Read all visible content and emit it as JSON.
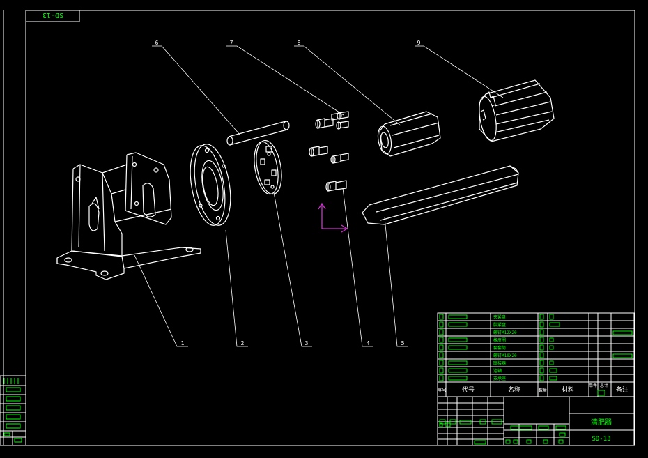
{
  "drawing": {
    "code_rotated": "SD-13",
    "title": "清肥器",
    "code": "SD-13"
  },
  "leaders": [
    "1",
    "2",
    "3",
    "4",
    "5",
    "6",
    "7",
    "8",
    "9"
  ],
  "bom": {
    "rows": [
      {
        "name": "夹紧盘"
      },
      {
        "name": "胶紧盘"
      },
      {
        "name": "螺钉M12X20"
      },
      {
        "name": "橡皮圈"
      },
      {
        "name": "套套筒"
      },
      {
        "name": "螺钉M10X20"
      },
      {
        "name": "联接器"
      },
      {
        "name": "连轴"
      },
      {
        "name": "支承座"
      }
    ],
    "header": {
      "seq": "序号",
      "code": "代号",
      "name": "名称",
      "qty": "数量",
      "material": "材料",
      "single": "单件",
      "total": "总计",
      "remark": "备注"
    }
  },
  "colors": {
    "line": "#ffffff",
    "accent": "#00ff00",
    "axis": "#cc33cc"
  }
}
